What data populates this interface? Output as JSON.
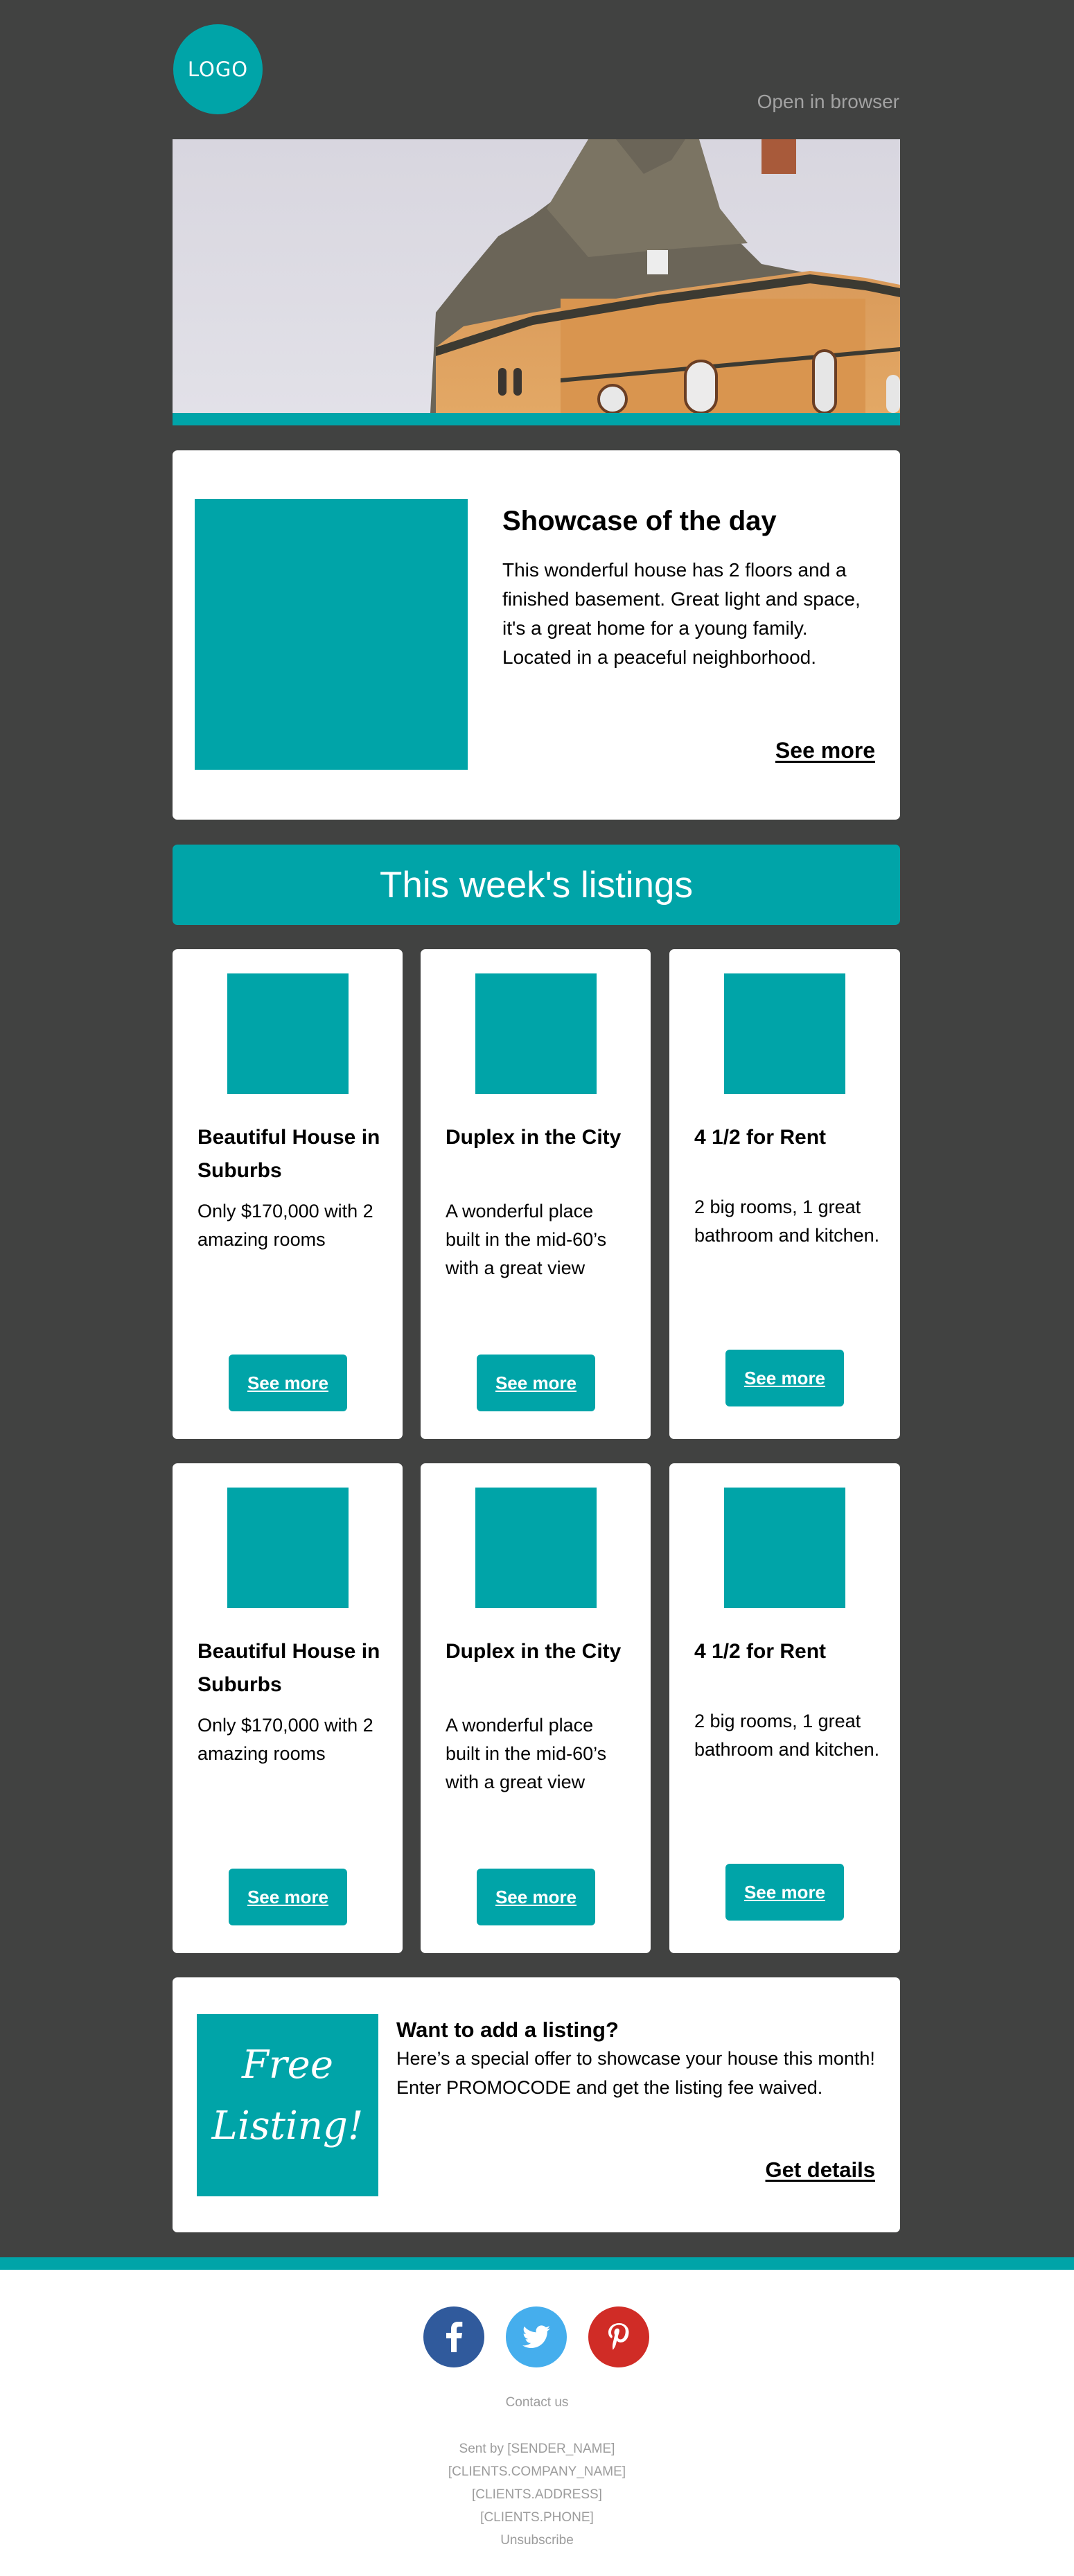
{
  "colors": {
    "accent": "#00a4a8",
    "background_dark": "#414241",
    "facebook": "#305a9c",
    "twitter": "#45aeed",
    "pinterest": "#d02c26"
  },
  "header": {
    "logo_text": "LOGO",
    "open_in_browser": "Open in browser"
  },
  "hero": {
    "image_alt": "house-photo"
  },
  "showcase": {
    "title": "Showcase of the day",
    "description": "This wonderful house has 2 floors and a finished basement. Great light and space, it's a great home for a young family. Located in a peaceful neighborhood.",
    "link": "See more"
  },
  "listings_banner": "This week's listings",
  "listings": [
    {
      "title": "Beautiful House in Suburbs",
      "description": "Only $170,000 with 2 amazing rooms",
      "button": "See more"
    },
    {
      "title": "Duplex in the City",
      "description": "A wonderful place built in the mid-60’s with a great view",
      "button": "See more"
    },
    {
      "title": "4 1/2 for Rent",
      "description": "2 big rooms, 1 great bathroom and kitchen.",
      "button": "See more"
    },
    {
      "title": "Beautiful House in Suburbs",
      "description": "Only $170,000 with 2 amazing rooms",
      "button": "See more"
    },
    {
      "title": "Duplex in the City",
      "description": "A wonderful place built in the mid-60’s with a great view",
      "button": "See more"
    },
    {
      "title": "4 1/2 for Rent",
      "description": "2 big rooms, 1 great bathroom and kitchen.",
      "button": "See more"
    }
  ],
  "promo": {
    "badge_line1": "Free",
    "badge_line2": "Listing!",
    "title": "Want to add a listing?",
    "description": "Here’s a special offer to showcase your house this month! Enter PROMOCODE and get the listing fee waived.",
    "link": "Get details"
  },
  "footer": {
    "social": [
      {
        "name": "facebook",
        "icon": "facebook-icon"
      },
      {
        "name": "twitter",
        "icon": "twitter-icon"
      },
      {
        "name": "pinterest",
        "icon": "pinterest-icon"
      }
    ],
    "contact": "Contact us",
    "sent_by": "Sent by [SENDER_NAME]",
    "company": "[CLIENTS.COMPANY_NAME]",
    "address": "[CLIENTS.ADDRESS]",
    "phone": "[CLIENTS.PHONE]",
    "unsubscribe": "Unsubscribe"
  }
}
